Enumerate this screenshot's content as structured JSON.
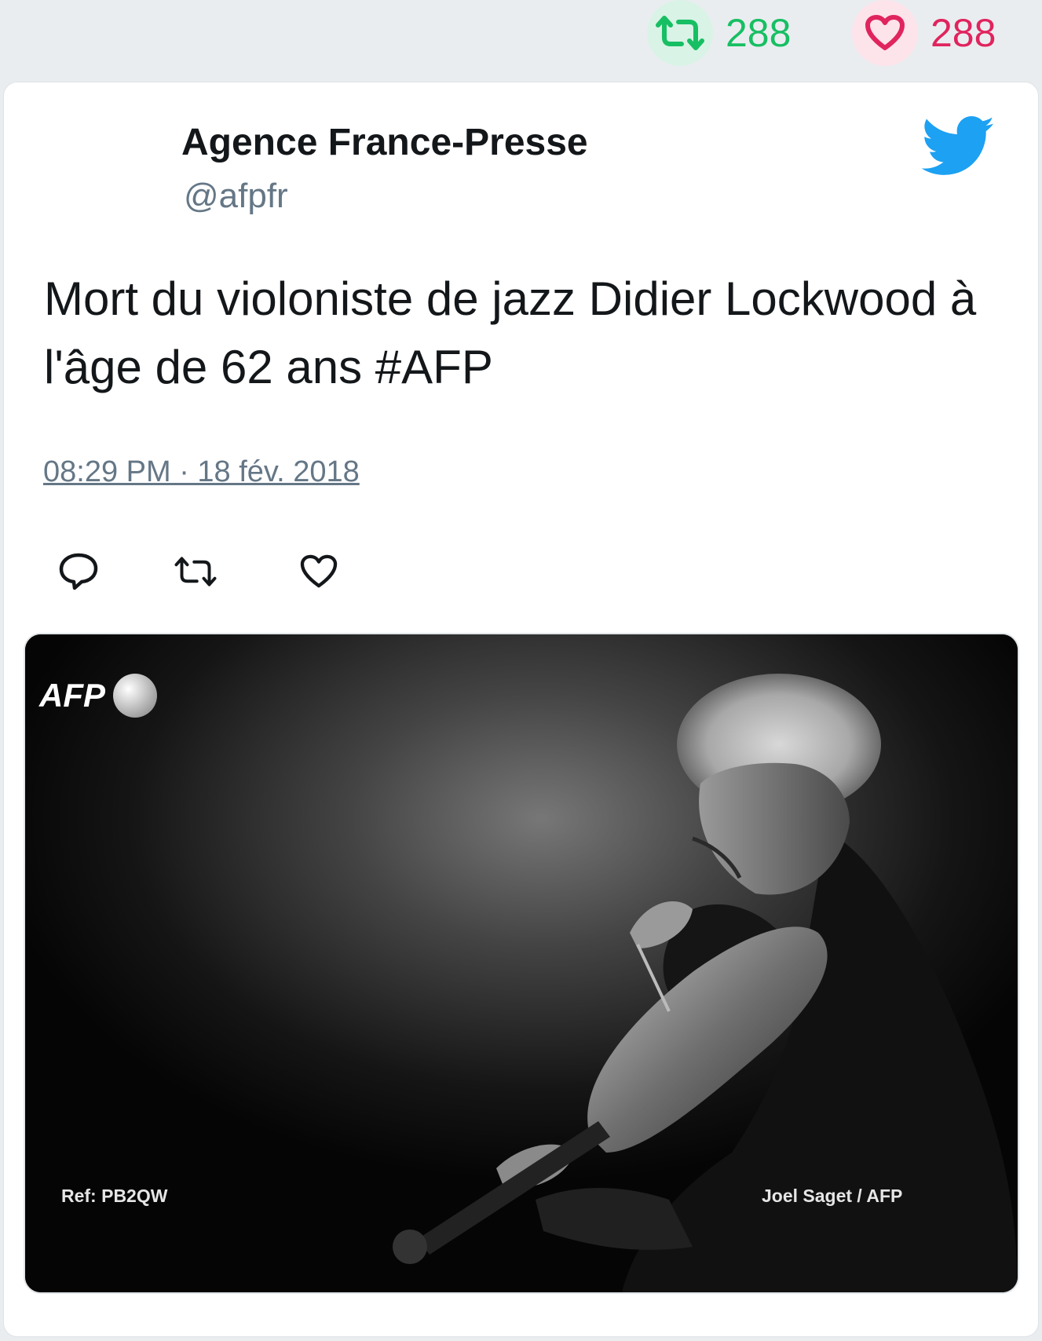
{
  "stats": {
    "retweets": "288",
    "likes": "288",
    "retweet_icon": "retweet-icon",
    "like_icon": "heart-icon",
    "retweet_color": "#17bf63",
    "like_color": "#e0245e"
  },
  "tweet": {
    "author_name": "Agence France-Presse",
    "author_handle": "@afpfr",
    "text": "Mort du violoniste de jazz Didier Lockwood à l'âge de 62 ans #AFP",
    "timestamp": "08:29 PM · 18 fév. 2018",
    "brand_icon": "twitter-bird-icon",
    "brand_color": "#1da1f2",
    "actions": [
      "reply-icon",
      "retweet-icon",
      "like-icon"
    ]
  },
  "media": {
    "ref": "Ref: PB2QW",
    "credit": "Joel Saget / AFP",
    "logo_text": "AFP"
  }
}
